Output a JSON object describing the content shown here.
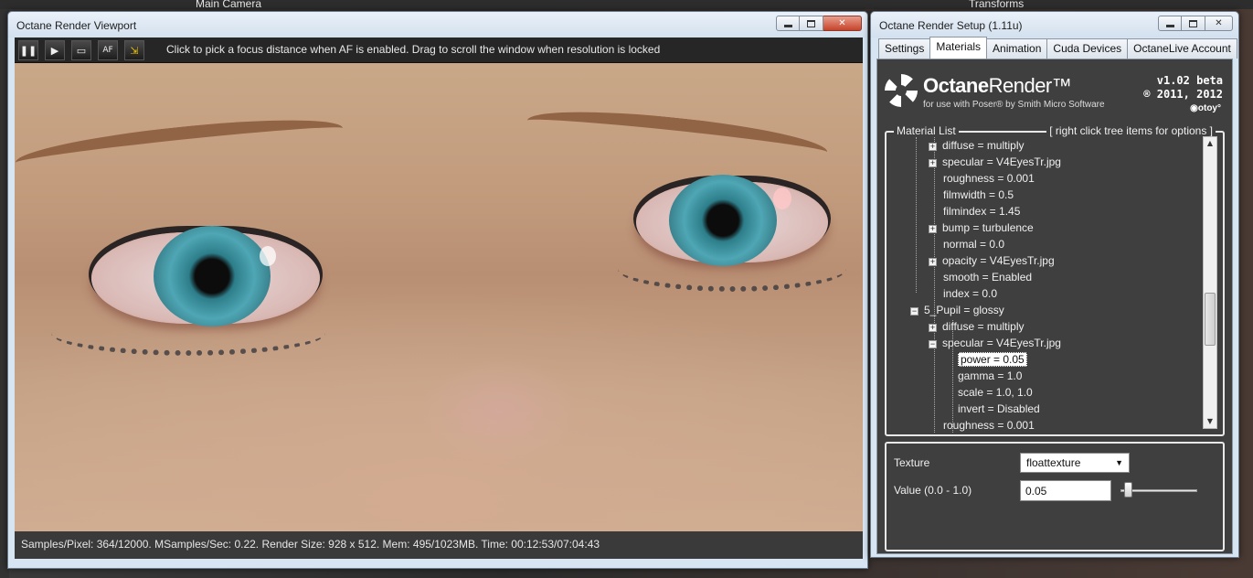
{
  "host": {
    "camera_label": "Main Camera",
    "transforms_label": "Transforms"
  },
  "viewport": {
    "title": "Octane Render Viewport",
    "toolbar": {
      "hint": "Click to pick a focus distance when AF is enabled.  Drag to scroll the window when resolution is locked",
      "af_label": "AF"
    },
    "status": "Samples/Pixel: 364/12000. MSamples/Sec: 0.22. Render Size: 928 x 512. Mem: 495/1023MB. Time: 00:12:53/07:04:43"
  },
  "setup": {
    "title": "Octane Render Setup (1.11u)",
    "tabs": [
      "Settings",
      "Materials",
      "Animation",
      "Cuda Devices",
      "OctaneLive Account"
    ],
    "active_tab": "Materials",
    "logo": {
      "name_bold": "Octane",
      "name_rest": "Render™",
      "subtitle": "for use with Poser® by Smith Micro Software",
      "version": "v1.02 beta",
      "copyright": "® 2011, 2012",
      "brand": "◉otoy°"
    },
    "material_list": {
      "legend_left": "Material List",
      "legend_right": "[ right click tree items for options ]",
      "rows": [
        {
          "text": "diffuse = multiply",
          "level": 1,
          "expander": "+"
        },
        {
          "text": "specular = V4EyesTr.jpg",
          "level": 1,
          "expander": "+"
        },
        {
          "text": "roughness = 0.001",
          "level": 1,
          "expander": ""
        },
        {
          "text": "filmwidth = 0.5",
          "level": 1,
          "expander": ""
        },
        {
          "text": "filmindex = 1.45",
          "level": 1,
          "expander": ""
        },
        {
          "text": "bump = turbulence",
          "level": 1,
          "expander": "+"
        },
        {
          "text": "normal = 0.0",
          "level": 1,
          "expander": ""
        },
        {
          "text": "opacity = V4EyesTr.jpg",
          "level": 1,
          "expander": "+"
        },
        {
          "text": "smooth = Enabled",
          "level": 1,
          "expander": ""
        },
        {
          "text": "index = 0.0",
          "level": 1,
          "expander": ""
        },
        {
          "text": "5_Pupil = glossy",
          "level": 0,
          "expander": "−"
        },
        {
          "text": "diffuse = multiply",
          "level": 1,
          "expander": "+"
        },
        {
          "text": "specular = V4EyesTr.jpg",
          "level": 1,
          "expander": "−"
        },
        {
          "text": "power = 0.05",
          "level": 2,
          "expander": "",
          "selected": true
        },
        {
          "text": "gamma = 1.0",
          "level": 2,
          "expander": ""
        },
        {
          "text": "scale = 1.0, 1.0",
          "level": 2,
          "expander": ""
        },
        {
          "text": "invert = Disabled",
          "level": 2,
          "expander": ""
        },
        {
          "text": "roughness = 0.001",
          "level": 1,
          "expander": ""
        }
      ]
    },
    "properties": {
      "texture_label": "Texture",
      "texture_value": "floattexture",
      "value_label": "Value (0.0 - 1.0)",
      "value": "0.05",
      "slider_fraction": 0.05
    }
  }
}
